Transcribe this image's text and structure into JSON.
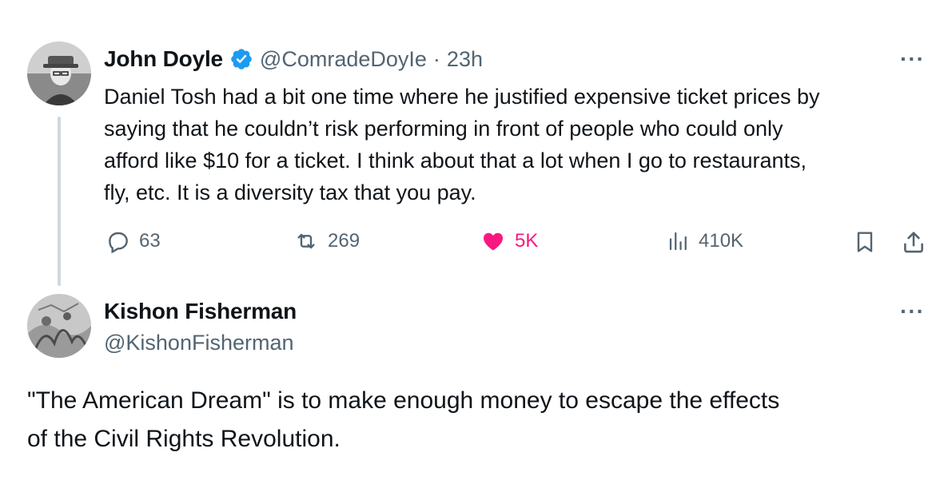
{
  "tweet1": {
    "author_name": "John Doyle",
    "handle": "@ComradeDoyIe",
    "separator": "·",
    "time": "23h",
    "more": "···",
    "text_lines": [
      "Daniel Tosh had a bit one time where he justified expensive ticket prices by",
      "saying that he couldn’t risk performing in front of people who could only",
      "afford like $10 for a ticket. I think about that a lot when I go to restaurants,",
      "fly, etc. It is a diversity tax that you pay."
    ],
    "stats": {
      "replies": "63",
      "reposts": "269",
      "likes": "5K",
      "views": "410K"
    }
  },
  "tweet2": {
    "author_name": "Kishon Fisherman",
    "handle": "@KishonFisherman",
    "more": "···",
    "text_lines": [
      "\"The American Dream\" is to make enough money to escape the effects",
      "of the Civil Rights Revolution."
    ]
  },
  "colors": {
    "verified_blue": "#1d9bf0",
    "like_pink": "#f91880",
    "muted": "#536471",
    "thread_line": "#cfd9de"
  },
  "icons": {
    "reply": "reply-icon",
    "repost": "repost-icon",
    "like": "heart-icon",
    "views": "views-icon",
    "bookmark": "bookmark-icon",
    "share": "share-icon",
    "verified": "verified-badge-icon"
  }
}
